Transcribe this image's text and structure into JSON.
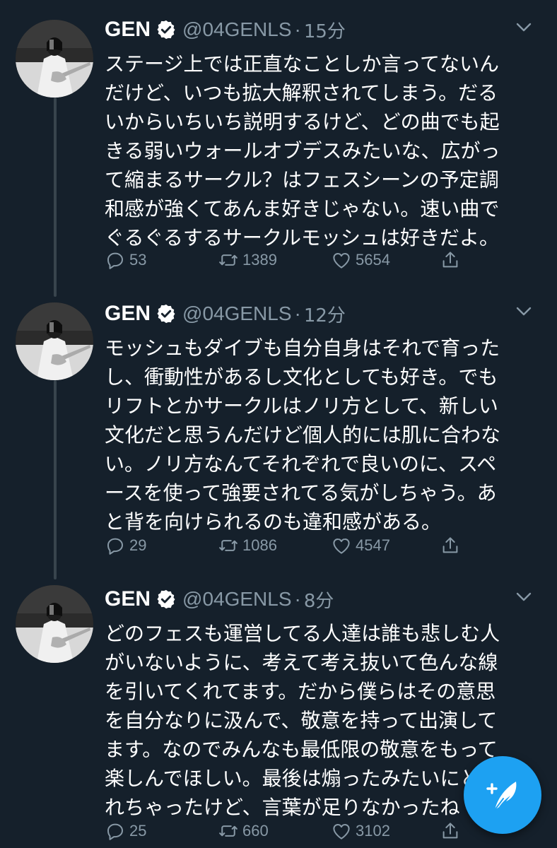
{
  "colors": {
    "background": "#15202b",
    "secondary_text": "#8899a6",
    "accent": "#1da1f2",
    "thread_line": "#38444d"
  },
  "tweets": [
    {
      "name": "GEN",
      "handle": "@04GENLS",
      "separator": "·",
      "time": "15分",
      "lines": [
        "ステージ上では正直なことしか言ってないん",
        "だけど、いつも拡大解釈されてしまう。だる",
        "いからいちいち説明するけど、どの曲でも起",
        "きる弱いウォールオブデスみたいな、広がっ",
        "て縮まるサークル？はフェスシーンの予定調",
        "和感が強くてあんま好きじゃない。速い曲で",
        "ぐるぐるするサークルモッシュは好きだよ。"
      ],
      "replies": "53",
      "retweets": "1389",
      "likes": "5654"
    },
    {
      "name": "GEN",
      "handle": "@04GENLS",
      "separator": "·",
      "time": "12分",
      "lines": [
        "モッシュもダイブも自分自身はそれで育った",
        "し、衝動性があるし文化としても好き。でも",
        "リフトとかサークルはノリ方として、新しい",
        "文化だと思うんだけど個人的には肌に合わな",
        "い。ノリ方なんてそれぞれで良いのに、スペ",
        "ースを使って強要されてる気がしちゃう。あ",
        "と背を向けられるのも違和感がある。"
      ],
      "replies": "29",
      "retweets": "1086",
      "likes": "4547"
    },
    {
      "name": "GEN",
      "handle": "@04GENLS",
      "separator": "·",
      "time": "8分",
      "lines": [
        "どのフェスも運営してる人達は誰も悲しむ人",
        "がいないように、考えて考え抜いて色んな線",
        "を引いてくれてます。だから僕らはその意思",
        "を自分なりに汲んで、敬意を持って出演して",
        "ます。なのでみんなも最低限の敬意をもって",
        "楽しんでほしい。最後は煽ったみたいにと",
        "れちゃったけど、言葉が足りなかったね"
      ],
      "replies": "25",
      "retweets": "660",
      "likes": "3102"
    }
  ],
  "icons": {
    "verified": "verified-badge-icon",
    "more": "chevron-down-icon",
    "reply": "reply-icon",
    "retweet": "retweet-icon",
    "like": "heart-icon",
    "share": "share-icon",
    "compose": "compose-tweet-icon"
  }
}
